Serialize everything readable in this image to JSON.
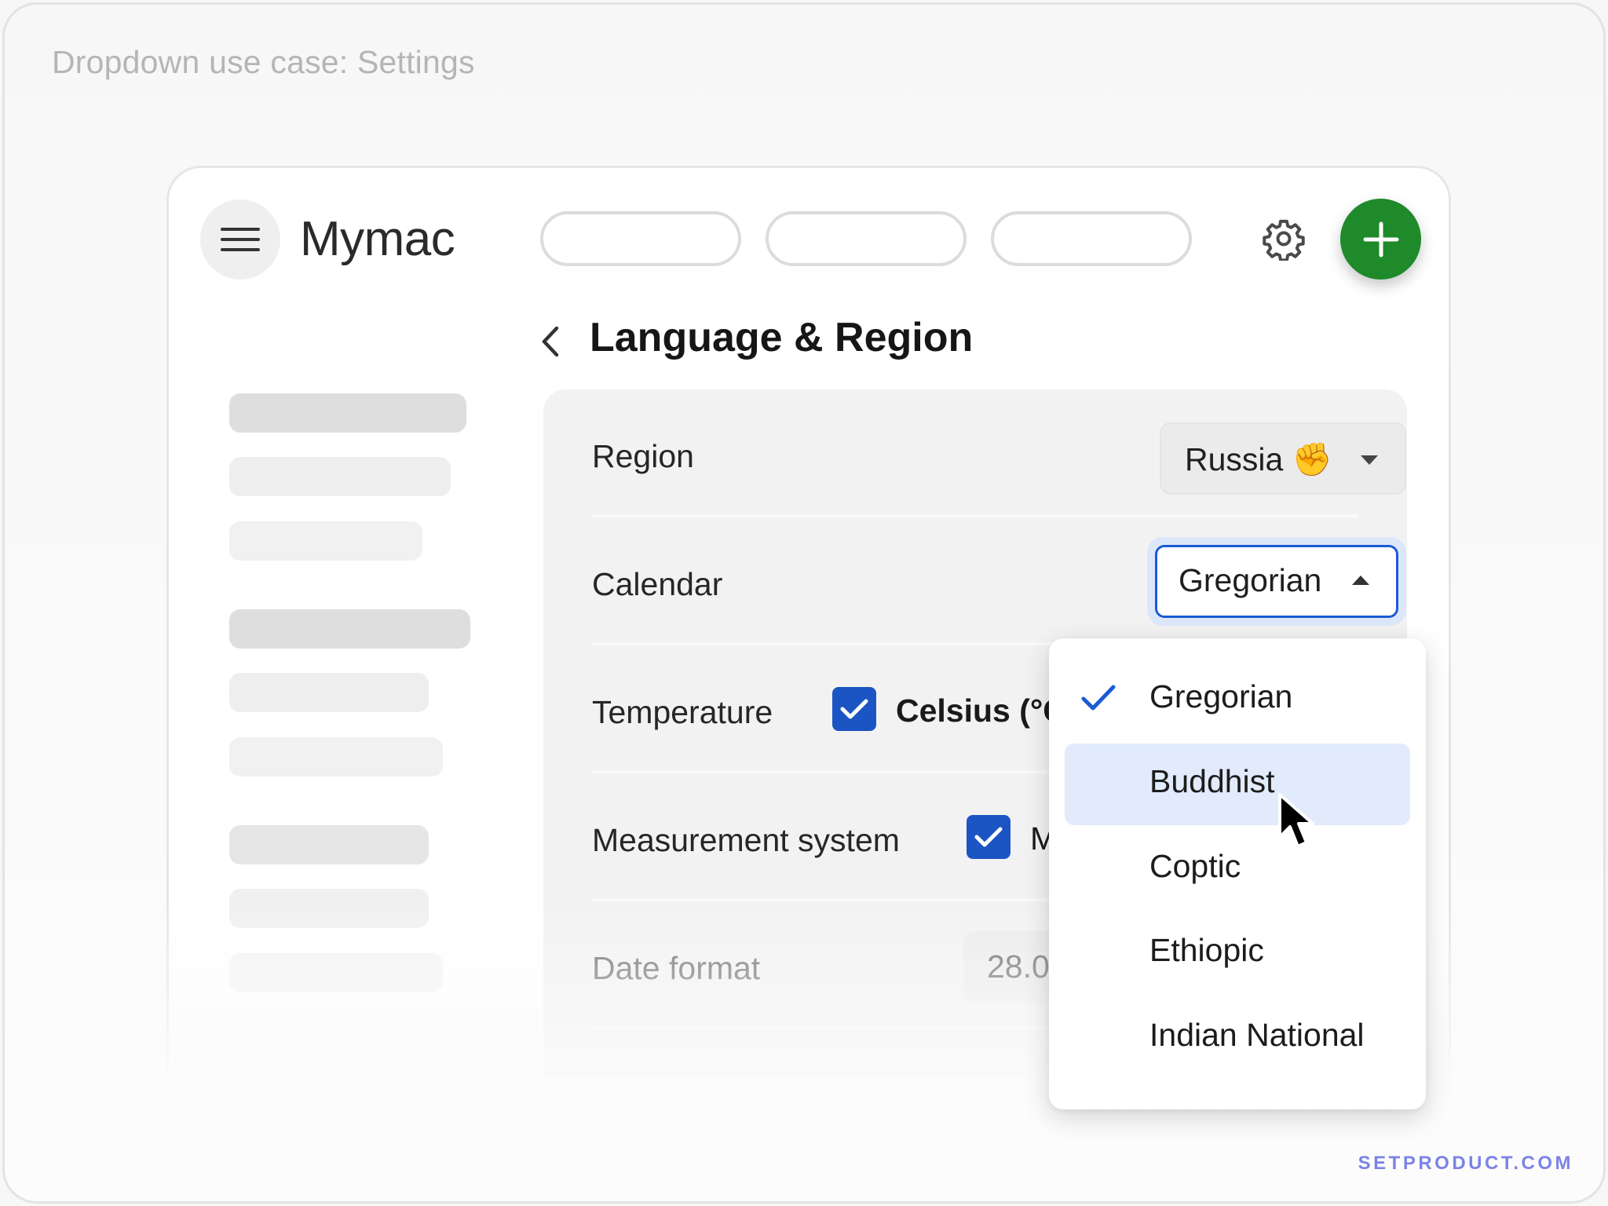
{
  "caption": "Dropdown use case: Settings",
  "watermark": "SETPRODUCT.COM",
  "app": {
    "title": "Mymac",
    "brand_color": "#1f8a2a",
    "accent_color": "#1b55c4",
    "menu_icon": "hamburger-icon",
    "settings_icon": "gear-icon",
    "add_icon": "plus-icon"
  },
  "page": {
    "back_icon": "chevron-left-icon",
    "title": "Language & Region"
  },
  "settings": {
    "region": {
      "label": "Region",
      "value": "Russia ✊"
    },
    "calendar": {
      "label": "Calendar",
      "value": "Gregorian"
    },
    "temperature": {
      "label": "Temperature",
      "option": "Celsius (°C"
    },
    "measurement": {
      "label": "Measurement system",
      "option": "M"
    },
    "date_format": {
      "label": "Date format",
      "value": "28.0"
    }
  },
  "calendar_dropdown": {
    "options": [
      "Gregorian",
      "Buddhist",
      "Coptic",
      "Ethiopic",
      "Indian National"
    ],
    "selected": "Gregorian",
    "hovered": "Buddhist"
  }
}
